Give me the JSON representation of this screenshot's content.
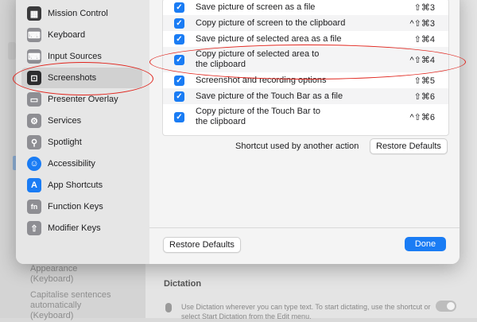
{
  "background": {
    "items": [
      "Appearance",
      "(Keyboard)",
      "Capitalise sentences",
      "automatically",
      "(Keyboard)"
    ],
    "dictation_title": "Dictation",
    "dictation_text": "Use Dictation wherever you can type text. To start dictating, use the shortcut or select Start Dictation from the Edit menu."
  },
  "sidebar": {
    "items": [
      {
        "label": "Mission Control",
        "icon": "mission-control-icon",
        "color": "#3a3a3c"
      },
      {
        "label": "Keyboard",
        "icon": "keyboard-icon",
        "color": "#8e8e93"
      },
      {
        "label": "Input Sources",
        "icon": "input-sources-icon",
        "color": "#8e8e93"
      },
      {
        "label": "Screenshots",
        "icon": "screenshot-icon",
        "color": "#2c2c2e"
      },
      {
        "label": "Presenter Overlay",
        "icon": "presenter-overlay-icon",
        "color": "#8e8e93"
      },
      {
        "label": "Services",
        "icon": "gear-icon",
        "color": "#8e8e93"
      },
      {
        "label": "Spotlight",
        "icon": "magnifier-icon",
        "color": "#8e8e93"
      },
      {
        "label": "Accessibility",
        "icon": "accessibility-icon",
        "color": "#1a7cf4"
      },
      {
        "label": "App Shortcuts",
        "icon": "app-store-icon",
        "color": "#1a7cf4"
      },
      {
        "label": "Function Keys",
        "icon": "fn-key-icon",
        "color": "#8e8e93"
      },
      {
        "label": "Modifier Keys",
        "icon": "arrow-up-icon",
        "color": "#8e8e93"
      }
    ],
    "selected": "Screenshots"
  },
  "shortcuts": [
    {
      "label": "Save picture of screen as a file",
      "shortcut": "⇧⌘3",
      "checked": true
    },
    {
      "label": "Copy picture of screen to the clipboard",
      "shortcut": "^⇧⌘3",
      "checked": true
    },
    {
      "label": "Save picture of selected area as a file",
      "shortcut": "⇧⌘4",
      "checked": true
    },
    {
      "label": "Copy picture of selected area to\nthe clipboard",
      "shortcut": "^⇧⌘4",
      "checked": true
    },
    {
      "label": "Screenshot and recording options",
      "shortcut": "⇧⌘5",
      "checked": true
    },
    {
      "label": "Save picture of the Touch Bar as a file",
      "shortcut": "⇧⌘6",
      "checked": true
    },
    {
      "label": "Copy picture of the Touch Bar to\nthe clipboard",
      "shortcut": "^⇧⌘6",
      "checked": true
    }
  ],
  "conflict_text": "Shortcut used by another action",
  "restore_defaults_label": "Restore Defaults",
  "done_label": "Done",
  "colors": {
    "accent": "#1a7cf4",
    "annotation": "#e0231b"
  }
}
